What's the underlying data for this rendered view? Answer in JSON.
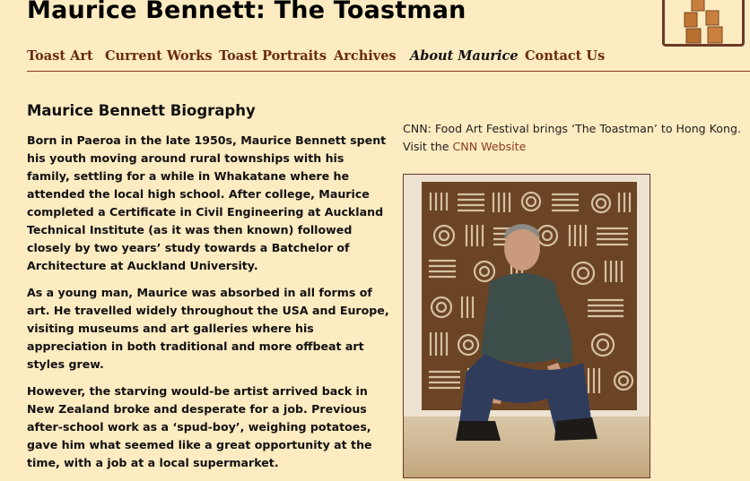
{
  "header": {
    "site_title": "Maurice Bennett: The Toastman"
  },
  "nav": {
    "items": [
      {
        "label": "Toast Art"
      },
      {
        "label": "Current Works"
      },
      {
        "label": "Toast Portraits"
      },
      {
        "label": "Archives"
      },
      {
        "label": "About Maurice"
      },
      {
        "label": "Contact Us"
      }
    ],
    "active": "About Maurice"
  },
  "main": {
    "heading": "Maurice Bennett Biography",
    "paragraphs": [
      "Born in Paeroa in the late 1950s, Maurice Bennett spent his youth moving around rural townships with his family, settling for a while in Whakatane where he attended the local high school. After college, Maurice completed a Certificate in Civil Engineering at Auckland Technical Institute (as it was then known) followed closely by two years’ study towards a Batchelor of Architecture at Auckland University.",
      "As a young man, Maurice was absorbed in all forms of art. He travelled widely throughout the USA and Europe, visiting museums and art galleries where his appreciation in both traditional and more offbeat art styles grew.",
      "However, the starving would-be artist arrived back in New Zealand broke and desperate for a job. Previous after-school work as a ‘spud-boy’, weighing potatoes, gave him what seemed like a great opportunity at the time, with a job at a local supermarket."
    ]
  },
  "sidebar": {
    "news_text": "CNN: Food Art Festival brings ‘The Toastman’ to Hong Kong.",
    "visit_prefix": "Visit the ",
    "link_label": "CNN Website"
  },
  "colors": {
    "background": "#fdebc1",
    "nav_link": "#6b2a12",
    "rule": "#8b3a1e"
  }
}
